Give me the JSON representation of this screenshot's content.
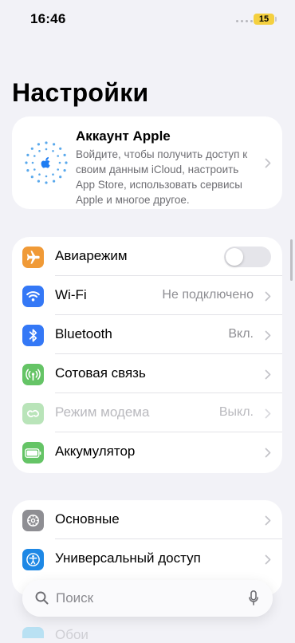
{
  "status": {
    "time": "16:46",
    "battery": "15"
  },
  "title": "Настройки",
  "account": {
    "title": "Аккаунт Apple",
    "description": "Войдите, чтобы получить доступ к своим данным iCloud, настроить App Store, использовать сервисы Apple и многое другое."
  },
  "group1": [
    {
      "label": "Авиарежим",
      "icon": "airplane-icon",
      "color": "#f09a37",
      "toggle": false
    },
    {
      "label": "Wi-Fi",
      "value": "Не подключено",
      "icon": "wifi-icon",
      "color": "#3478f6"
    },
    {
      "label": "Bluetooth",
      "value": "Вкл.",
      "icon": "bluetooth-icon",
      "color": "#3478f6"
    },
    {
      "label": "Сотовая связь",
      "icon": "cellular-icon",
      "color": "#65c466"
    },
    {
      "label": "Режим модема",
      "value": "Выкл.",
      "icon": "hotspot-icon",
      "color": "#65c466"
    },
    {
      "label": "Аккумулятор",
      "icon": "battery-icon",
      "color": "#65c466"
    }
  ],
  "group2": [
    {
      "label": "Основные",
      "icon": "gear-icon",
      "color": "#8e8e93"
    },
    {
      "label": "Универсальный доступ",
      "icon": "accessibility-icon",
      "color": "#1e88e5"
    }
  ],
  "peek": {
    "label": "Обои"
  },
  "search": {
    "placeholder": "Поиск"
  }
}
